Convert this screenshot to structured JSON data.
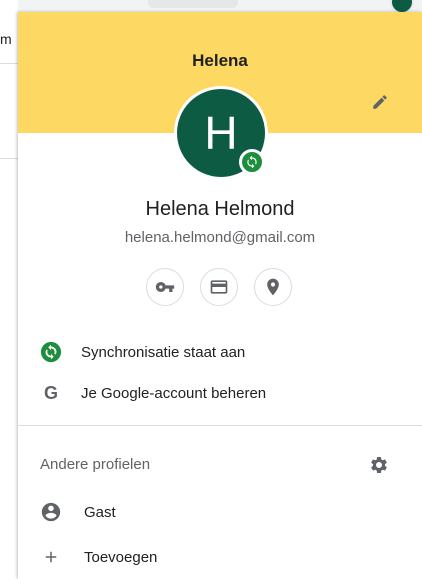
{
  "background": {
    "left_fragment": "m"
  },
  "profile": {
    "header_title": "Helena",
    "avatar_letter": "H",
    "full_name": "Helena Helmond",
    "email": "helena.helmond@gmail.com"
  },
  "quick_actions": [
    {
      "icon": "key-icon"
    },
    {
      "icon": "credit-card-icon"
    },
    {
      "icon": "location-pin-icon"
    }
  ],
  "menu": {
    "sync_label": "Synchronisatie staat aan",
    "google_account_label": "Je Google-account beheren",
    "google_letter": "G"
  },
  "other_profiles": {
    "title": "Andere profielen",
    "guest_label": "Gast",
    "add_label": "Toevoegen"
  },
  "colors": {
    "header_bg": "#fdd963",
    "avatar_bg": "#0d5b43",
    "sync_green": "#1e8e3e"
  }
}
